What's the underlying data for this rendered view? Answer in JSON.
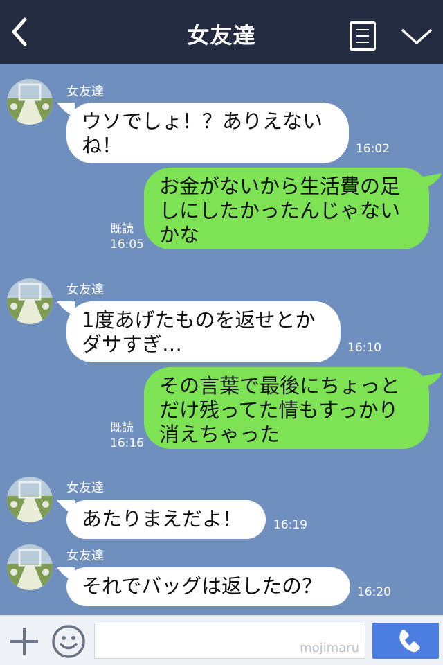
{
  "header": {
    "title": "女友達",
    "back_icon": "chevron-left-icon",
    "menu_icon": "note-menu-icon",
    "collapse_icon": "chevron-down-icon"
  },
  "messages": [
    {
      "side": "in",
      "sender": "女友達",
      "text": "ウソでしょ！？ありえない\nね！",
      "time": "16:02"
    },
    {
      "side": "out",
      "status": "既読",
      "text": "お金がないから生活費の足\nしにしたかったんじゃない\nかな",
      "time": "16:05"
    },
    {
      "side": "in",
      "sender": "女友達",
      "text": "1度あげたものを返せとか\nダサすぎ…",
      "time": "16:10"
    },
    {
      "side": "out",
      "status": "既読",
      "text": "その言葉で最後にちょっと\nだけ残ってた情もすっかり\n消えちゃった",
      "time": "16:16"
    },
    {
      "side": "in",
      "sender": "女友達",
      "text": "あたりまえだよ！",
      "time": "16:19"
    },
    {
      "side": "in",
      "sender": "女友達",
      "text": "それでバッグは返したの？",
      "time": "16:20"
    }
  ],
  "footer": {
    "plus_icon": "plus-icon",
    "emoji_icon": "smiley-icon",
    "input_value": "",
    "watermark": "mojimaru",
    "call_icon": "phone-icon"
  },
  "colors": {
    "header_bg": "#232b40",
    "chat_bg": "#6f8fbf",
    "incoming_bubble": "#ffffff",
    "outgoing_bubble": "#7de354",
    "call_button": "#4d7fe3"
  }
}
